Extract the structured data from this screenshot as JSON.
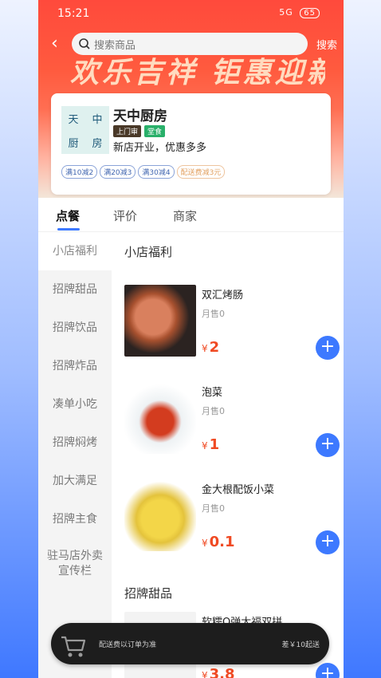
{
  "status": {
    "time": "15:21",
    "network": "5G",
    "battery": "65"
  },
  "search": {
    "placeholder": "搜索商品",
    "button_label": "搜索"
  },
  "banner": {
    "art_text": "欢乐吉祥 钜惠迎新"
  },
  "shop": {
    "name": "天中厨房",
    "logo_chars": [
      "天",
      "中",
      "厨",
      "房"
    ],
    "tags": [
      "上门审",
      "堂食"
    ],
    "slogan": "新店开业，优惠多多",
    "promos": [
      "满10减2",
      "满20减3",
      "满30减4",
      "配送费减3元"
    ]
  },
  "tabs": [
    "点餐",
    "评价",
    "商家"
  ],
  "sidebar": {
    "items": [
      "小店福利",
      "招牌甜品",
      "招牌饮品",
      "招牌炸品",
      "凑单小吃",
      "招牌焖烤",
      "加大满足",
      "招牌主食",
      "驻马店外卖宣传栏"
    ]
  },
  "sections": [
    {
      "title": "小店福利",
      "products": [
        {
          "name": "双汇烤肠",
          "sold": "月售0",
          "currency": "¥",
          "price": "2"
        },
        {
          "name": "泡菜",
          "sold": "月售0",
          "currency": "¥",
          "price": "1"
        },
        {
          "name": "金大根配饭小菜",
          "sold": "月售0",
          "currency": "¥",
          "price": "0.1"
        }
      ]
    },
    {
      "title": "招牌甜品",
      "products": [
        {
          "name": "软糯Q弹大福双拼",
          "sold": "",
          "currency": "¥",
          "price": "3.8"
        }
      ]
    }
  ],
  "cart": {
    "fee_note": "配送费以订单为准",
    "diff_note": "差￥10起送"
  },
  "colors": {
    "accent": "#3d79ff",
    "price": "#f04a23",
    "banner": "#ff4a3c"
  }
}
